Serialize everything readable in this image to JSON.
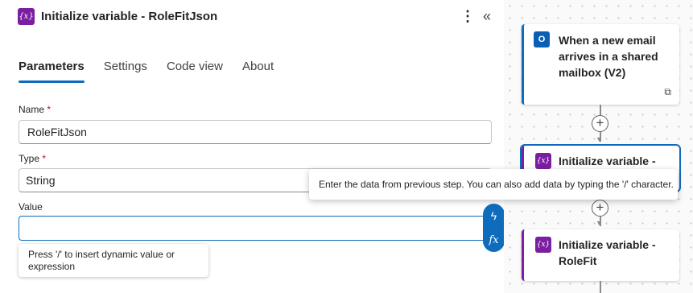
{
  "panel": {
    "title": "Initialize variable - RoleFitJson",
    "icon": "variable-icon",
    "more_icon": "⋮",
    "collapse_icon": "«"
  },
  "tabs": [
    {
      "label": "Parameters",
      "active": true
    },
    {
      "label": "Settings",
      "active": false
    },
    {
      "label": "Code view",
      "active": false
    },
    {
      "label": "About",
      "active": false
    }
  ],
  "fields": {
    "name": {
      "label": "Name",
      "required_mark": "*",
      "value": "RoleFitJson"
    },
    "type": {
      "label": "Type",
      "required_mark": "*",
      "value": "String"
    },
    "value": {
      "label": "Value",
      "value": ""
    }
  },
  "hint": "Press '/' to insert dynamic value or expression",
  "tooltip": "Enter the data from previous step. You can also add data by typing the '/' character.",
  "side_buttons": {
    "dynamic": "ϟ",
    "expression": "fx"
  },
  "canvas": {
    "trigger": {
      "title": "When a new email arrives in a shared mailbox (V2)",
      "icon": "outlook-icon"
    },
    "steps": [
      {
        "title": "Initialize variable -",
        "icon_text": "{x}"
      },
      {
        "title": "Initialize variable - RoleFit",
        "icon_text": "{x}"
      }
    ]
  },
  "colors": {
    "accent": "#0f6cbd",
    "variable": "#7b1fa2",
    "required": "#c50f1f"
  }
}
